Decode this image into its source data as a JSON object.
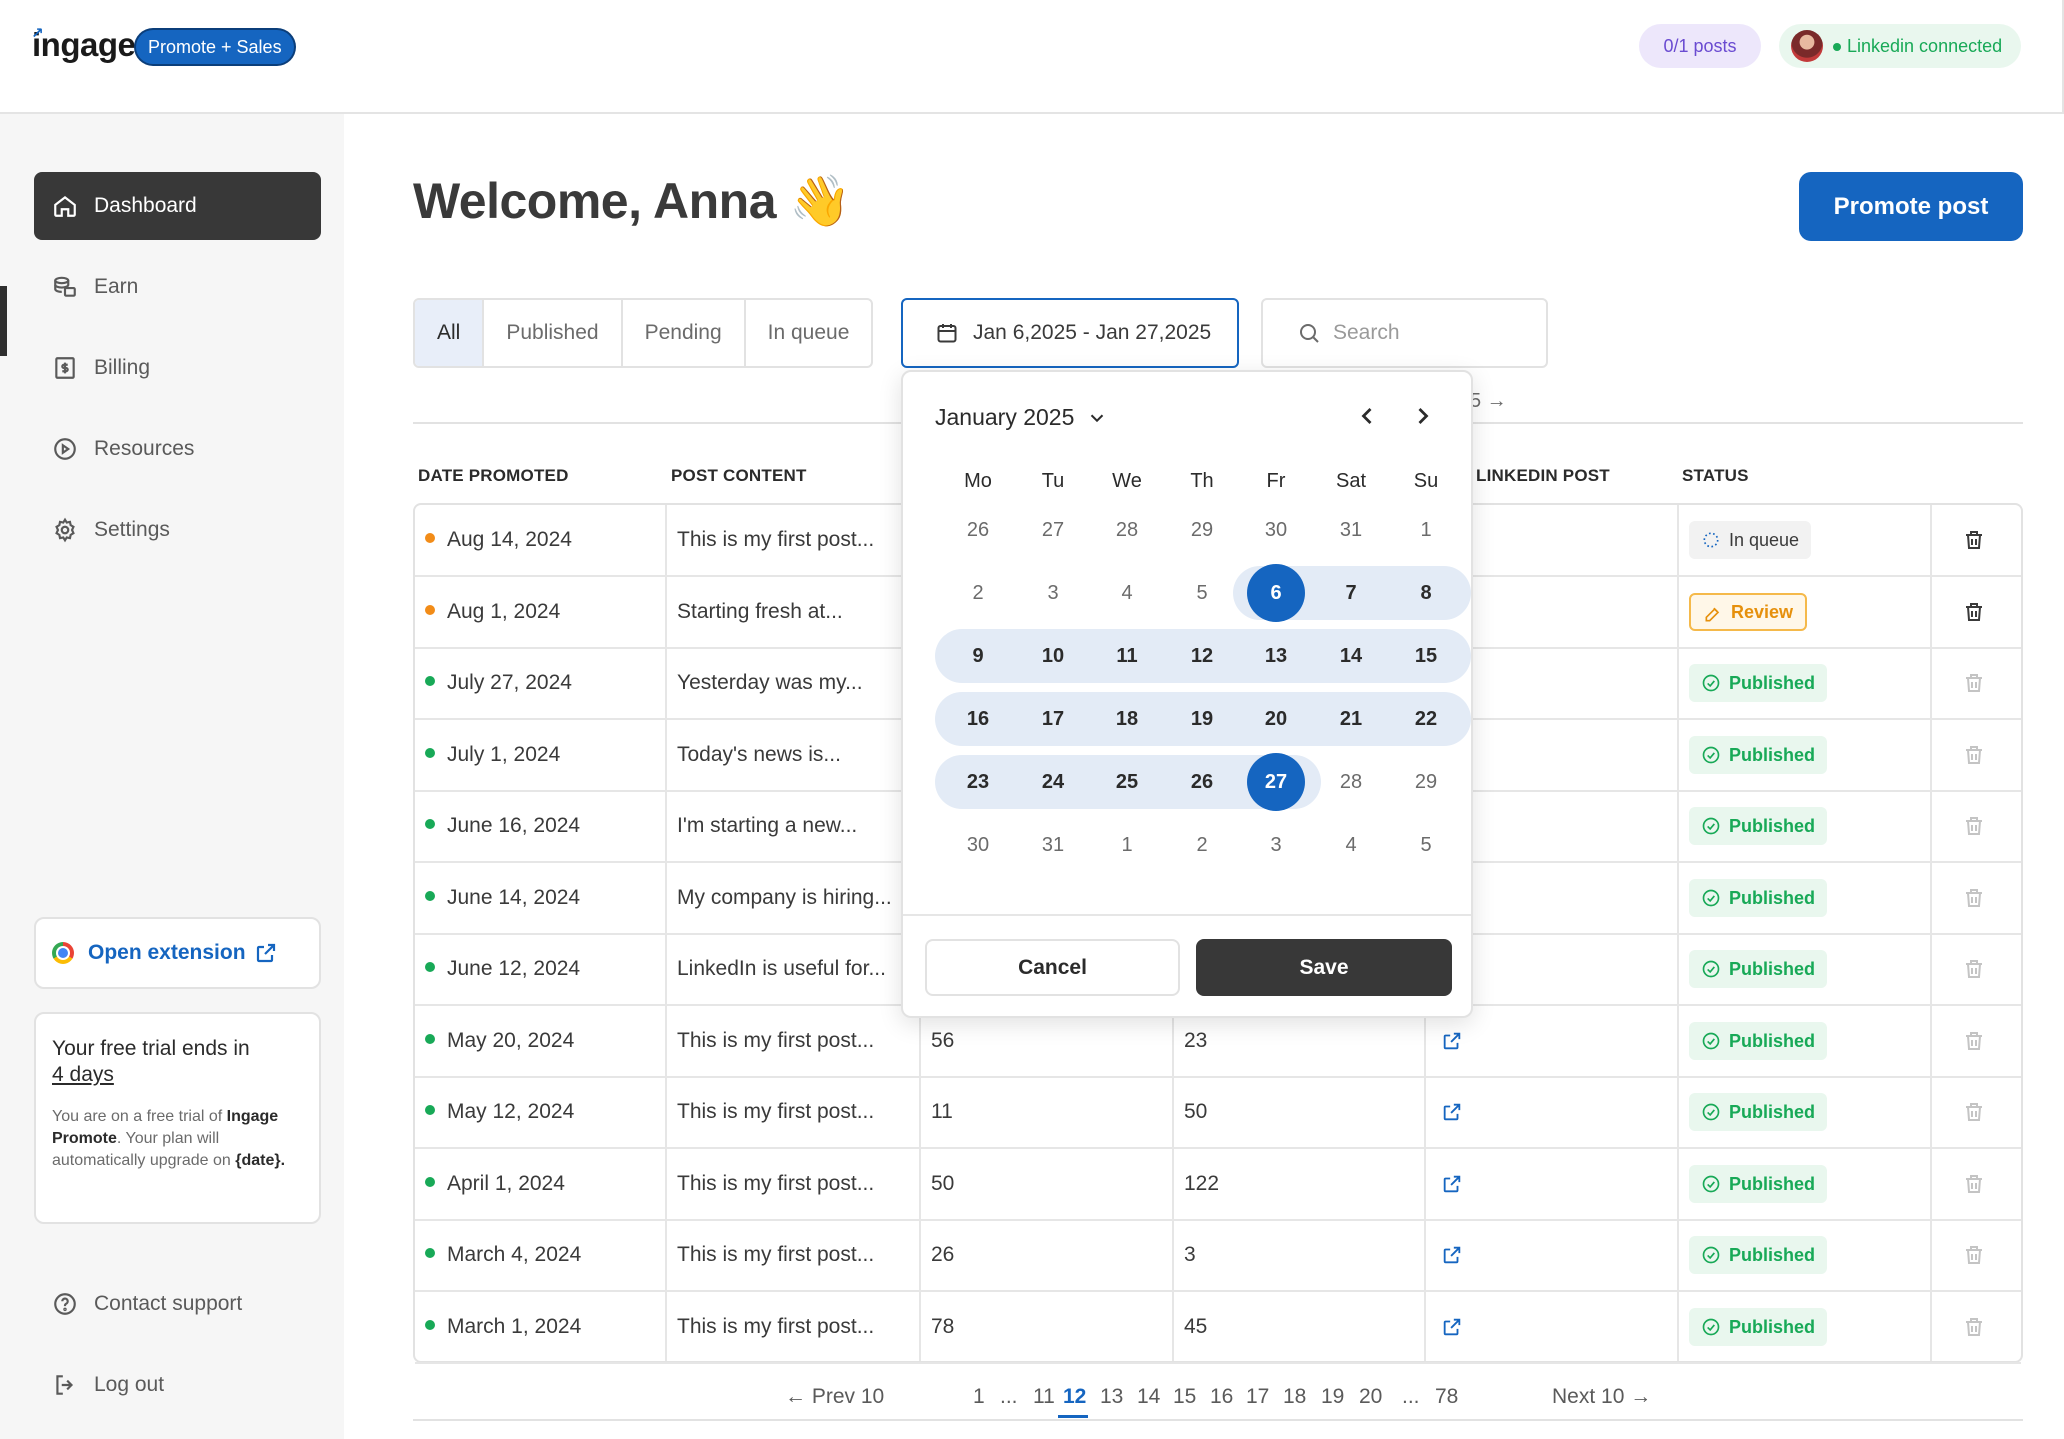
{
  "header": {
    "logo": "ingage",
    "plan_badge": "Promote + Sales",
    "posts_count": "0/1 posts",
    "linkedin_status": "Linkedin connected"
  },
  "sidebar": {
    "items": [
      {
        "label": "Dashboard",
        "icon": "home-icon",
        "active": true
      },
      {
        "label": "Earn",
        "icon": "coins-icon"
      },
      {
        "label": "Billing",
        "icon": "billing-icon"
      },
      {
        "label": "Resources",
        "icon": "play-circle-icon"
      },
      {
        "label": "Settings",
        "icon": "gear-icon"
      }
    ],
    "extension_label": "Open extension",
    "trial": {
      "title_prefix": "Your free trial ends in",
      "days": "4 days",
      "body_1": "You are on a free trial of",
      "plan_name": "Ingage Promote",
      "body_2": ". Your plan will automatically upgrade on",
      "date_placeholder": "{date}",
      "body_3": "."
    },
    "contact_support": "Contact support",
    "logout": "Log out"
  },
  "main": {
    "welcome": "Welcome, Anna 👋",
    "promote_button": "Promote post",
    "filters": [
      "All",
      "Published",
      "Pending",
      "In queue"
    ],
    "active_filter": "All",
    "date_range": "Jan 6,2025 - Jan 27,2025",
    "search_placeholder": "Search",
    "hidden_header_fragment": "5 →"
  },
  "table": {
    "headers": {
      "date": "DATE PROMOTED",
      "content": "POST CONTENT",
      "linkedin": "LINKEDIN POST",
      "status": "STATUS"
    },
    "rows": [
      {
        "date": "Aug 14, 2024",
        "content": "This is my first post...",
        "c3": "",
        "c4": "",
        "link": false,
        "status": "In queue",
        "kind": "queue",
        "dot": "#f28c18"
      },
      {
        "date": "Aug 1, 2024",
        "content": "Starting fresh at...",
        "c3": "",
        "c4": "",
        "link": false,
        "status": "Review",
        "kind": "review",
        "dot": "#f28c18"
      },
      {
        "date": "July 27, 2024",
        "content": "Yesterday was my...",
        "c3": "",
        "c4": "",
        "link": false,
        "status": "Published",
        "kind": "pub",
        "dot": "#18a957"
      },
      {
        "date": "July 1, 2024",
        "content": "Today's news is...",
        "c3": "",
        "c4": "",
        "link": false,
        "status": "Published",
        "kind": "pub",
        "dot": "#18a957"
      },
      {
        "date": "June 16, 2024",
        "content": "I'm starting a new...",
        "c3": "",
        "c4": "",
        "link": false,
        "status": "Published",
        "kind": "pub",
        "dot": "#18a957"
      },
      {
        "date": "June 14, 2024",
        "content": "My company is hiring...",
        "c3": "",
        "c4": "",
        "link": false,
        "status": "Published",
        "kind": "pub",
        "dot": "#18a957"
      },
      {
        "date": "June 12, 2024",
        "content": "LinkedIn is useful for...",
        "c3": "",
        "c4": "",
        "link": false,
        "status": "Published",
        "kind": "pub",
        "dot": "#18a957"
      },
      {
        "date": "May 20, 2024",
        "content": "This is my first post...",
        "c3": "56",
        "c4": "23",
        "link": true,
        "status": "Published",
        "kind": "pub",
        "dot": "#18a957"
      },
      {
        "date": "May 12, 2024",
        "content": "This is my first post...",
        "c3": "11",
        "c4": "50",
        "link": true,
        "status": "Published",
        "kind": "pub",
        "dot": "#18a957"
      },
      {
        "date": "April 1, 2024",
        "content": "This is my first post...",
        "c3": "50",
        "c4": "122",
        "link": true,
        "status": "Published",
        "kind": "pub",
        "dot": "#18a957"
      },
      {
        "date": "March 4, 2024",
        "content": "This is my first post...",
        "c3": "26",
        "c4": "3",
        "link": true,
        "status": "Published",
        "kind": "pub",
        "dot": "#18a957"
      },
      {
        "date": "March 1, 2024",
        "content": "This is my first post...",
        "c3": "78",
        "c4": "45",
        "link": true,
        "status": "Published",
        "kind": "pub",
        "dot": "#18a957"
      }
    ]
  },
  "pagination": {
    "prev": "← Prev 10",
    "next": "Next 10 →",
    "pages": [
      "1",
      "...",
      "11",
      "12",
      "13",
      "14",
      "15",
      "16",
      "17",
      "18",
      "19",
      "20",
      "...",
      "78"
    ],
    "current": "12"
  },
  "calendar": {
    "month_label": "January 2025",
    "weekdays": [
      "Mo",
      "Tu",
      "We",
      "Th",
      "Fr",
      "Sat",
      "Su"
    ],
    "weeks": [
      [
        "26",
        "27",
        "28",
        "29",
        "30",
        "31",
        "1"
      ],
      [
        "2",
        "3",
        "4",
        "5",
        "6",
        "7",
        "8"
      ],
      [
        "9",
        "10",
        "11",
        "12",
        "13",
        "14",
        "15"
      ],
      [
        "16",
        "17",
        "18",
        "19",
        "20",
        "21",
        "22"
      ],
      [
        "23",
        "24",
        "25",
        "26",
        "27",
        "28",
        "29"
      ],
      [
        "30",
        "31",
        "1",
        "2",
        "3",
        "4",
        "5"
      ]
    ],
    "range_start": "6",
    "range_end": "27",
    "cancel_label": "Cancel",
    "save_label": "Save"
  },
  "colors": {
    "accent": "#1565c0",
    "success": "#18a957",
    "warning": "#f28c18",
    "dark": "#383838"
  }
}
